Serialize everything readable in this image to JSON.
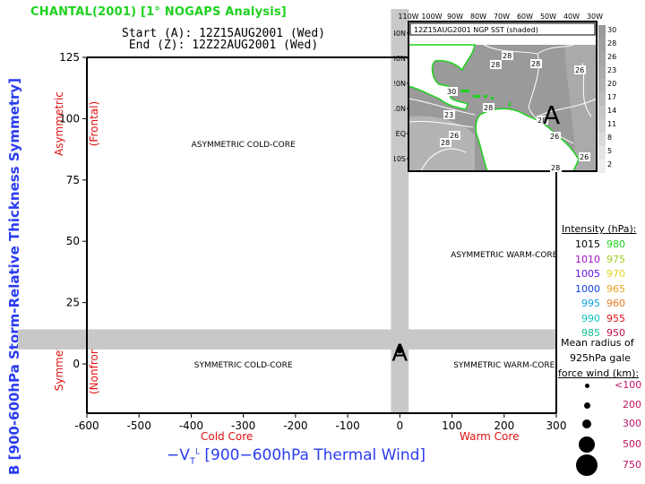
{
  "header": {
    "title": "CHANTAL(2001) [1° NOGAPS Analysis]",
    "start_line": "Start (A): 12Z15AUG2001 (Wed)",
    "end_line": " End (Z): 12Z22AUG2001 (Wed)"
  },
  "colors": {
    "title": "#1ed21e",
    "axis_title": "#2a3cf0",
    "annotation_red": "#e01010",
    "band_gray": "#c8c8c8",
    "coastline": "#1ed21e"
  },
  "chart_data": {
    "type": "scatter",
    "title": "CHANTAL(2001) [1° NOGAPS Analysis]",
    "xlabel": "-Vt^L [900-600hPa Thermal Wind]",
    "ylabel": "B [900-600hPa Storm-Relative Thickness Symmetry]",
    "xlim": [
      -600,
      300
    ],
    "ylim": [
      -19,
      125
    ],
    "xticks": [
      -600,
      -500,
      -400,
      -300,
      -200,
      -100,
      0,
      100,
      200,
      300
    ],
    "xtick_labels": [
      "-600",
      "-500",
      "-400",
      "-300",
      "-200",
      "-100",
      "0",
      "100",
      "200",
      "300"
    ],
    "yticks": [
      0,
      25,
      50,
      75,
      100,
      125
    ],
    "ytick_labels": [
      "0",
      "25",
      "50",
      "75",
      "100",
      "125"
    ],
    "grid": false,
    "x_annotations": {
      "cold": "Cold Core",
      "warm": "Warm Core"
    },
    "y_annotations": {
      "asym": [
        "Asymmetric",
        "(Frontal)"
      ],
      "sym": [
        "Symmetric",
        "(Nonfrontal)"
      ]
    },
    "quadrant_labels": [
      {
        "text": "ASYMMETRIC COLD-CORE",
        "x": -300,
        "y": 90
      },
      {
        "text": "ASYMMETRIC WARM-CORE",
        "x": 200,
        "y": 45
      },
      {
        "text": "SYMMETRIC COLD-CORE",
        "x": -300,
        "y": 0
      },
      {
        "text": "SYMMETRIC WARM-CORE",
        "x": 200,
        "y": 0
      }
    ],
    "reference_bands": {
      "vertical_x": [
        -17,
        17
      ],
      "horizontal_y": [
        7,
        13
      ]
    },
    "points": [
      {
        "label": "A",
        "x": 0,
        "y": 5,
        "intensity_hpa": 1010,
        "radius_km": 200
      }
    ],
    "legend_placement": "right"
  },
  "inset_map": {
    "title": "12Z15AUG2001 NGP SST (shaded)",
    "lon_labels": [
      "110W",
      "100W",
      "90W",
      "80W",
      "70W",
      "60W",
      "50W",
      "40W",
      "30W"
    ],
    "lat_labels": [
      "40N",
      "30N",
      "20N",
      "10N",
      "EQ",
      "10S"
    ],
    "contour_labels": [
      "28",
      "28",
      "28",
      "26",
      "30",
      "28",
      "28",
      "26",
      "23",
      "26",
      "28",
      "28",
      "26"
    ],
    "marker": "A",
    "colorbar_labels": [
      "30",
      "28",
      "26",
      "23",
      "20",
      "17",
      "14",
      "11",
      "8",
      "5",
      "2"
    ]
  },
  "legend": {
    "intensity_title": "Intensity (hPa):",
    "intensity_rows": [
      {
        "left": "1015",
        "left_color": "#000000",
        "right": "980",
        "right_color": "#1ed21e"
      },
      {
        "left": "1010",
        "left_color": "#a010c8",
        "right": "975",
        "right_color": "#9ad21e"
      },
      {
        "left": "1005",
        "left_color": "#6010e0",
        "right": "970",
        "right_color": "#e6d21e"
      },
      {
        "left": "1000",
        "left_color": "#1040e0",
        "right": "965",
        "right_color": "#e6a01e"
      },
      {
        "left": "995",
        "left_color": "#10a0e0",
        "right": "960",
        "right_color": "#e6781e"
      },
      {
        "left": "990",
        "left_color": "#10c0c0",
        "right": "955",
        "right_color": "#e01010"
      },
      {
        "left": "985",
        "left_color": "#10c090",
        "right": "950",
        "right_color": "#c01050"
      }
    ],
    "radius_title_1": "Mean radius of",
    "radius_title_2": "925hPa gale",
    "radius_title_3": "force wind (km):",
    "radius_rows": [
      {
        "label": "<100",
        "size": "xs"
      },
      {
        "label": "200",
        "size": "s"
      },
      {
        "label": "300",
        "size": "m"
      },
      {
        "label": "500",
        "size": "l"
      },
      {
        "label": "750",
        "size": "xl"
      }
    ],
    "radius_label_color": "#c01060"
  }
}
